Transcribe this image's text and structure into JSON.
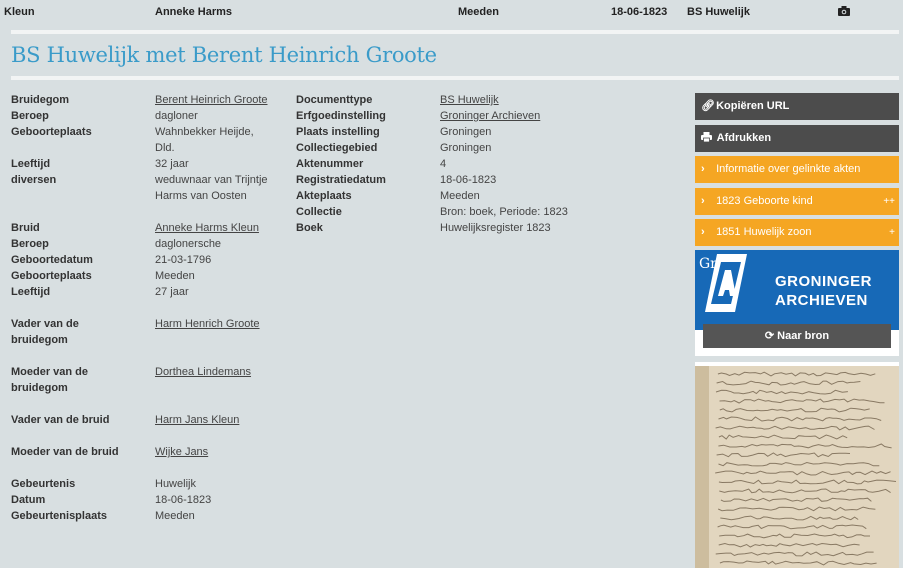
{
  "topbar": {
    "c1": "Kleun",
    "c2": "Anneke Harms",
    "c3": "Meeden",
    "c4": "18-06-1823",
    "c5": "BS Huwelijk"
  },
  "title": "BS Huwelijk met Berent Heinrich Groote",
  "left": [
    {
      "label": "Bruidegom",
      "value": "Berent Heinrich Groote",
      "link": true
    },
    {
      "label": "Beroep",
      "value": "dagloner"
    },
    {
      "label": "Geboorteplaats",
      "value": "Wahnbekker Heijde, Dld."
    },
    {
      "label": "Leeftijd",
      "value": "32 jaar"
    },
    {
      "label": "diversen",
      "value": "weduwnaar van Trijntje Harms van Oosten"
    },
    {
      "label": "Bruid",
      "value": "Anneke Harms Kleun",
      "link": true
    },
    {
      "label": "Beroep",
      "value": "daglonersche"
    },
    {
      "label": "Geboortedatum",
      "value": "21-03-1796"
    },
    {
      "label": "Geboorteplaats",
      "value": "Meeden"
    },
    {
      "label": "Leeftijd",
      "value": "27 jaar"
    },
    {
      "label": "Vader van de bruidegom",
      "value": "Harm Henrich Groote",
      "link": true
    },
    {
      "label": "Moeder van de bruidegom",
      "value": "Dorthea Lindemans",
      "link": true
    },
    {
      "label": "Vader van de bruid",
      "value": "Harm Jans Kleun",
      "link": true
    },
    {
      "label": "Moeder van de bruid",
      "value": "Wijke Jans",
      "link": true
    },
    {
      "label": "Gebeurtenis",
      "value": "Huwelijk"
    },
    {
      "label": "Datum",
      "value": "18-06-1823"
    },
    {
      "label": "Gebeurtenisplaats",
      "value": "Meeden"
    }
  ],
  "middle": [
    {
      "label": "Documenttype",
      "value": "BS Huwelijk",
      "link": true
    },
    {
      "label": "Erfgoedinstelling",
      "value": "Groninger Archieven",
      "link": true
    },
    {
      "label": "Plaats instelling",
      "value": "Groningen"
    },
    {
      "label": "Collectiegebied",
      "value": "Groningen"
    },
    {
      "label": "Aktenummer",
      "value": "4"
    },
    {
      "label": "Registratiedatum",
      "value": "18-06-1823"
    },
    {
      "label": "Akteplaats",
      "value": "Meeden"
    },
    {
      "label": "Collectie",
      "value": "Bron: boek, Periode: 1823"
    },
    {
      "label": "Boek",
      "value": "Huwelijksregister 1823"
    }
  ],
  "sidebar": {
    "copy_url": "Kopiëren URL",
    "print": "Afdrukken",
    "info": "Informatie over gelinkte akten",
    "link1": "1823 Geboorte kind",
    "link1_badge": "++",
    "link2": "1851 Huwelijk zoon",
    "link2_badge": "+",
    "logo_mark": "Gr",
    "logo_line1": "GRONINGER",
    "logo_line2": "ARCHIEVEN",
    "naar_bron": "Naar bron"
  },
  "colors": {
    "title": "#3a9bc9",
    "orange": "#f5a623",
    "dark_button": "#4c4c4c",
    "logo_blue": "#1769b7"
  }
}
